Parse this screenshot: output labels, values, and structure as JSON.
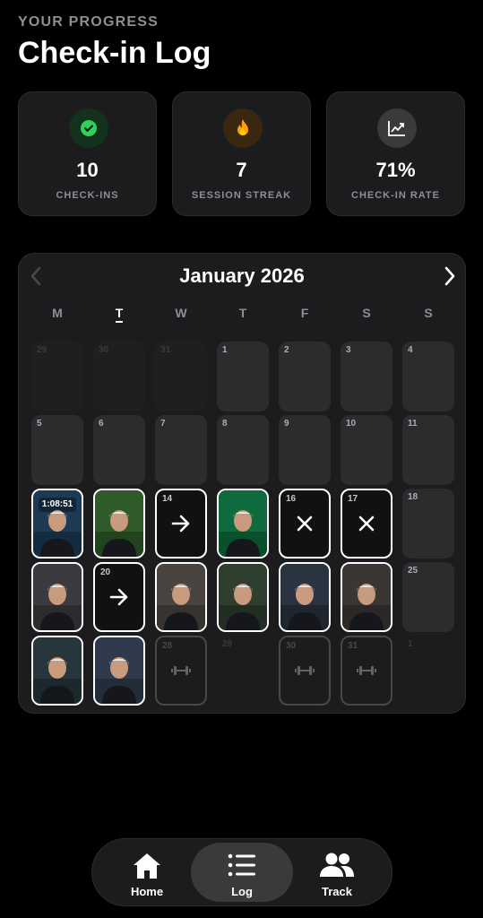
{
  "header": {
    "eyebrow": "YOUR PROGRESS",
    "title": "Check-in Log"
  },
  "stats": [
    {
      "value": "10",
      "label": "CHECK-INS",
      "icon": "check-circle-icon",
      "color": "#30d158"
    },
    {
      "value": "7",
      "label": "SESSION STREAK",
      "icon": "flame-icon",
      "color": "#ff9f0a"
    },
    {
      "value": "71%",
      "label": "CHECK-IN RATE",
      "icon": "trend-chart-icon",
      "color": "#ffffff"
    }
  ],
  "calendar": {
    "month": "January 2026",
    "weekdays": [
      "M",
      "T",
      "W",
      "T",
      "F",
      "S",
      "S"
    ],
    "today_index": 1,
    "weeks": [
      [
        {
          "day": "29",
          "state": "out"
        },
        {
          "day": "30",
          "state": "out"
        },
        {
          "day": "31",
          "state": "out"
        },
        {
          "day": "1",
          "state": "empty"
        },
        {
          "day": "2",
          "state": "empty"
        },
        {
          "day": "3",
          "state": "empty"
        },
        {
          "day": "4",
          "state": "empty"
        }
      ],
      [
        {
          "day": "5",
          "state": "empty"
        },
        {
          "day": "6",
          "state": "empty"
        },
        {
          "day": "7",
          "state": "empty"
        },
        {
          "day": "8",
          "state": "empty"
        },
        {
          "day": "9",
          "state": "empty"
        },
        {
          "day": "10",
          "state": "empty"
        },
        {
          "day": "11",
          "state": "empty"
        }
      ],
      [
        {
          "day": "",
          "state": "photo",
          "overlay": "1:08:51"
        },
        {
          "day": "",
          "state": "photo"
        },
        {
          "day": "14",
          "state": "rest"
        },
        {
          "day": "",
          "state": "photo"
        },
        {
          "day": "16",
          "state": "missed"
        },
        {
          "day": "17",
          "state": "missed"
        },
        {
          "day": "18",
          "state": "empty"
        }
      ],
      [
        {
          "day": "",
          "state": "photo"
        },
        {
          "day": "20",
          "state": "rest"
        },
        {
          "day": "",
          "state": "photo"
        },
        {
          "day": "",
          "state": "photo"
        },
        {
          "day": "",
          "state": "photo"
        },
        {
          "day": "",
          "state": "photo"
        },
        {
          "day": "25",
          "state": "empty"
        }
      ],
      [
        {
          "day": "",
          "state": "photo"
        },
        {
          "day": "",
          "state": "photo"
        },
        {
          "day": "28",
          "state": "planned"
        },
        {
          "day": "29",
          "state": "blank"
        },
        {
          "day": "30",
          "state": "planned"
        },
        {
          "day": "31",
          "state": "planned"
        },
        {
          "day": "1",
          "state": "blank"
        }
      ]
    ]
  },
  "tabs": [
    {
      "label": "Home",
      "icon": "home-icon",
      "active": false
    },
    {
      "label": "Log",
      "icon": "list-icon",
      "active": true
    },
    {
      "label": "Track",
      "icon": "people-icon",
      "active": false
    }
  ]
}
